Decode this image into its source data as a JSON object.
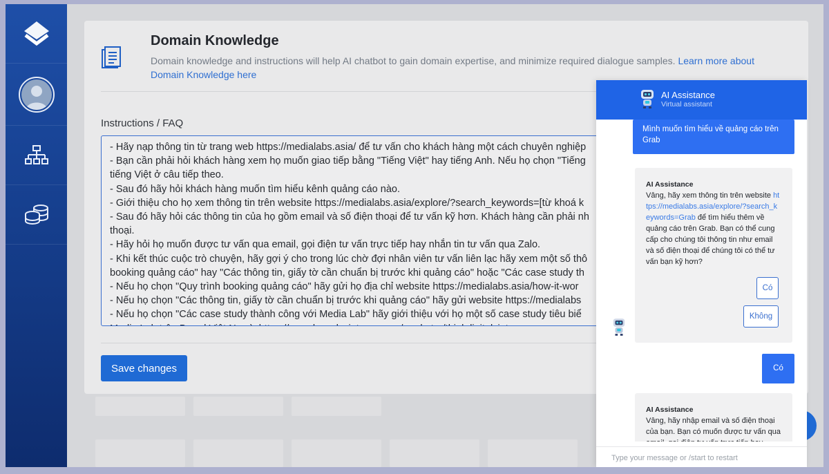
{
  "page": {
    "title": "Domain Knowledge",
    "description": "Domain knowledge and instructions will help AI chatbot to gain domain expertise, and minimize required dialogue samples.",
    "learn_more": "Learn more about Domain Knowledge here",
    "field_label": "Instructions / FAQ",
    "save_label": "Save changes"
  },
  "instructions": [
    "- Hãy nạp thông tin từ trang web https://medialabs.asia/ để tư vấn cho khách hàng một cách chuyên nghiệp",
    "- Bạn cần phải hỏi khách hàng xem họ muốn giao tiếp bằng \"Tiếng Việt\" hay tiếng Anh. Nếu họ chọn \"Tiếng",
    "tiếng Việt ở câu tiếp theo.",
    "- Sau đó hãy hỏi khách hàng muốn tìm hiểu kênh quảng cáo nào.",
    "- Giới thiệu cho họ xem thông tin trên website https://medialabs.asia/explore/?search_keywords=[từ khoá k",
    "- Sau đó hãy hỏi các thông tin của họ gồm email và số điện thoại để tư vấn kỹ hơn. Khách hàng cần phải nh",
    "thoại.",
    "- Hãy hỏi họ muốn được tư vấn qua email, gọi điện tư vấn trực tiếp hay nhắn tin tư vấn qua Zalo.",
    "- Khi kết thúc cuộc trò chuyện, hãy gợi ý cho trong lúc chờ đợi nhân viên tư vấn liên lạc hãy xem một số thô",
    "booking quảng cáo\" hay \"Các thông tin, giấy tờ cần chuẩn bị trước khi quảng cáo\" hoặc \"Các case study th",
    "- Nếu họ chọn \"Quy trình booking quảng cáo\" hãy gửi họ địa chỉ website https://medialabs.asia/how-it-wor",
    "- Nếu họ chọn \"Các thông tin, giấy tờ cần chuẩn bị trước khi quảng cáo\" hãy gửi website https://medialabs",
    "- Nếu họ chọn \"Các case study thành công với Media Lab\" hãy giới thiệu với họ một số case study tiêu biể",
    "Media Lab trên Brand Việt Nam): https://www.brandsvietnam.com/marketer/thinkdigitalvietnam"
  ],
  "chat": {
    "title": "AI Assistance",
    "subtitle": "Virtual assistant",
    "user_msg_1": "Mình muốn tìm hiểu về quảng cáo trên Grab",
    "bot_msg_1": {
      "sender": "AI Assistance",
      "text_before": "Vâng, hãy xem thông tin trên website",
      "link": "https://medialabs.asia/explore/?search_keywords=Grab",
      "text_after": "để tìm hiểu thêm về quảng cáo trên Grab. Bạn có thể cung cấp cho chúng tôi thông tin như email và số điện thoại để chúng tôi có thể tư vấn bạn kỹ hơn?"
    },
    "option_yes": "Có",
    "option_no": "Không",
    "user_msg_2": "Có",
    "bot_msg_2": {
      "sender": "AI Assistance",
      "text": "Vâng, hãy nhập email và số điện thoại của bạn. Bạn có muốn được tư vấn qua email, gọi điện tư vấn trực tiếp hay"
    },
    "input_placeholder": "Type your message or /start to restart"
  },
  "colors": {
    "accent": "#1f6ad4",
    "chat_header": "#1f64e6",
    "sidebar": "#163f8e"
  }
}
